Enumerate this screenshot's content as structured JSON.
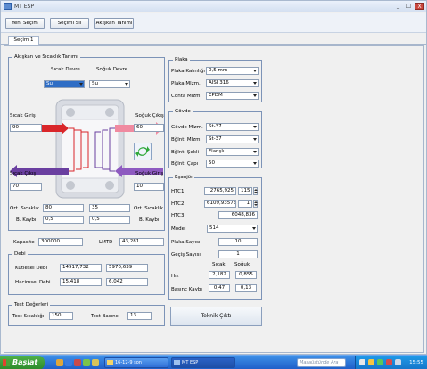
{
  "window": {
    "title": "MT ESP",
    "buttons": {
      "minimize": "_",
      "maximize": "□",
      "close": "X"
    }
  },
  "toolbar": {
    "new_selection": "Yeni Seçim",
    "delete_selection": "Seçimi Sil",
    "fluid_definition": "Akışkan Tanımı"
  },
  "tabs": [
    {
      "label": "Seçim 1"
    }
  ],
  "fluid": {
    "title": "Akışkan ve Sıcaklık Tanımı",
    "hot_fluid_label": "Sıcak Devre",
    "cold_fluid_label": "Soğuk Devre",
    "hot_fluid": "Su",
    "cold_fluid": "Su",
    "hot_in_label": "Sıcak Giriş",
    "hot_in": "90",
    "cold_out_label": "Soğuk Çıkış",
    "cold_out": "60",
    "hot_out_label": "Sıcak Çıkış",
    "hot_out": "70",
    "cold_in_label": "Soğuk Giriş",
    "cold_in": "10",
    "avg_temp_label": "Ort. Sıcaklık",
    "avg_hot": "80",
    "avg_cold": "35",
    "avg_temp_label_right": "Ort. Sıcaklık",
    "density_label": "B. Kaybı",
    "density_hot": "0,5",
    "density_cold": "0,5",
    "density_label_right": "B. Kaybı",
    "swap_icon": "swap-arrows"
  },
  "capacity": {
    "label": "Kapasite",
    "value": "300000",
    "lmtd_label": "LMTD",
    "lmtd": "43,281"
  },
  "flow": {
    "title": "Debi",
    "mass_label": "Kütlesel Debi",
    "mass_hot": "14917,732",
    "mass_cold": "5970,639",
    "vol_label": "Hacimsel Debi",
    "vol_hot": "15,418",
    "vol_cold": "6,042"
  },
  "test": {
    "title": "Test Değerleri",
    "temp_label": "Test Sıcaklığı",
    "temp": "150",
    "pressure_label": "Test Basıncı",
    "pressure": "13"
  },
  "plate": {
    "title": "Plaka",
    "thickness_label": "Plaka Kalınlığı",
    "thickness": "0,5 mm",
    "material_label": "Plaka Mlzm.",
    "material": "AISI 316",
    "gasket_label": "Conta Mlzm.",
    "gasket": "EPDM"
  },
  "body": {
    "title": "Gövde",
    "body_mat_label": "Gövde Mlzm.",
    "body_mat": "St-37",
    "conn_mat_label": "Bğlnt. Mlzm.",
    "conn_mat": "St-37",
    "conn_type_label": "Bğlnt. Şekli",
    "conn_type": "Flanşlı",
    "conn_dia_label": "Bğlnt. Çapı",
    "conn_dia": "50"
  },
  "exchanger": {
    "title": "Eşanjör",
    "htc1_label": "HTC1",
    "htc1": "2765,925",
    "htc1_pct": "115",
    "htc2_label": "HTC2",
    "htc2": "6109,93575",
    "htc2_pct": "1",
    "htc3_label": "HTC3",
    "htc3": "6048,836",
    "model_label": "Model",
    "model": "514",
    "plates_label": "Plaka Sayısı",
    "plates": "10",
    "passes_label": "Geçiş Sayısı",
    "passes": "1",
    "hot_col": "Sıcak",
    "cold_col": "Soğuk",
    "speed_label": "Hız",
    "speed_hot": "2,182",
    "speed_cold": "0,855",
    "dp_label": "Basınç Kaybı",
    "dp_hot": "0,47",
    "dp_cold": "0,13"
  },
  "tech_button": "Teknik Çıktı",
  "taskbar": {
    "start": "Başlat",
    "tasks": [
      {
        "label": "16-12-9 son"
      },
      {
        "label": "MT ESP"
      }
    ],
    "search_placeholder": "Masaüstünde Ara",
    "clock": "15:55"
  },
  "colors": {
    "hot": "#d9262a",
    "cold": "#6a3fa0",
    "accent": "#2e6dc5"
  }
}
